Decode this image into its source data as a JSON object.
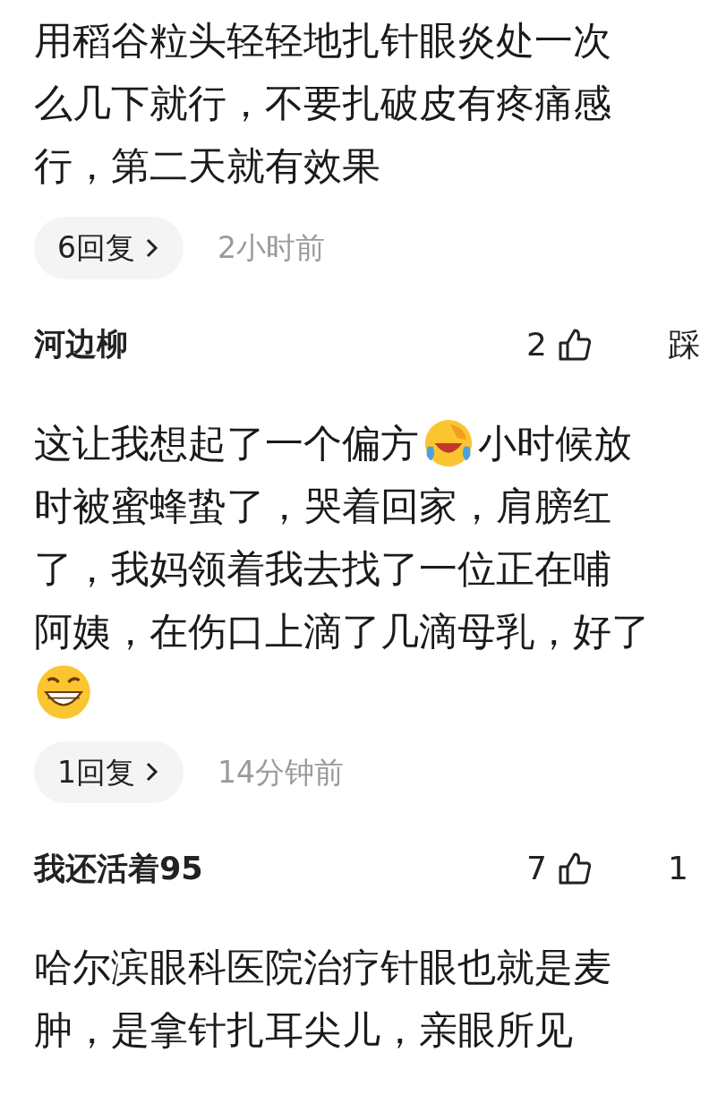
{
  "comments": [
    {
      "body_lines": [
        [
          {
            "kind": "text",
            "text": "用稻谷粒头轻轻地扎针眼炎处一次"
          }
        ],
        [
          {
            "kind": "text",
            "text": "么几下就行，不要扎破皮有疼痛感"
          }
        ],
        [
          {
            "kind": "text",
            "text": "行，第二天就有效果"
          }
        ]
      ],
      "replies": "6回复",
      "time": "2小时前"
    },
    {
      "author": "河边柳",
      "likes": "2",
      "dislike": "踩",
      "body_lines": [
        [
          {
            "kind": "text",
            "text": "这让我想起了一个偏方"
          },
          {
            "kind": "emoji-tears"
          },
          {
            "kind": "text",
            "text": "小时候放"
          }
        ],
        [
          {
            "kind": "text",
            "text": "时被蜜蜂蛰了，哭着回家，肩膀红"
          }
        ],
        [
          {
            "kind": "text",
            "text": "了，我妈领着我去找了一位正在哺"
          }
        ],
        [
          {
            "kind": "text",
            "text": "阿姨，在伤口上滴了几滴母乳，好了"
          }
        ],
        [
          {
            "kind": "emoji-grin"
          }
        ]
      ],
      "replies": "1回复",
      "time": "14分钟前"
    },
    {
      "author": "我还活着95",
      "likes": "7",
      "dislike": "1",
      "body_lines": [
        [
          {
            "kind": "text",
            "text": "哈尔滨眼科医院治疗针眼也就是麦"
          }
        ],
        [
          {
            "kind": "text",
            "text": "肿，是拿针扎耳尖儿，亲眼所见"
          }
        ]
      ]
    }
  ]
}
